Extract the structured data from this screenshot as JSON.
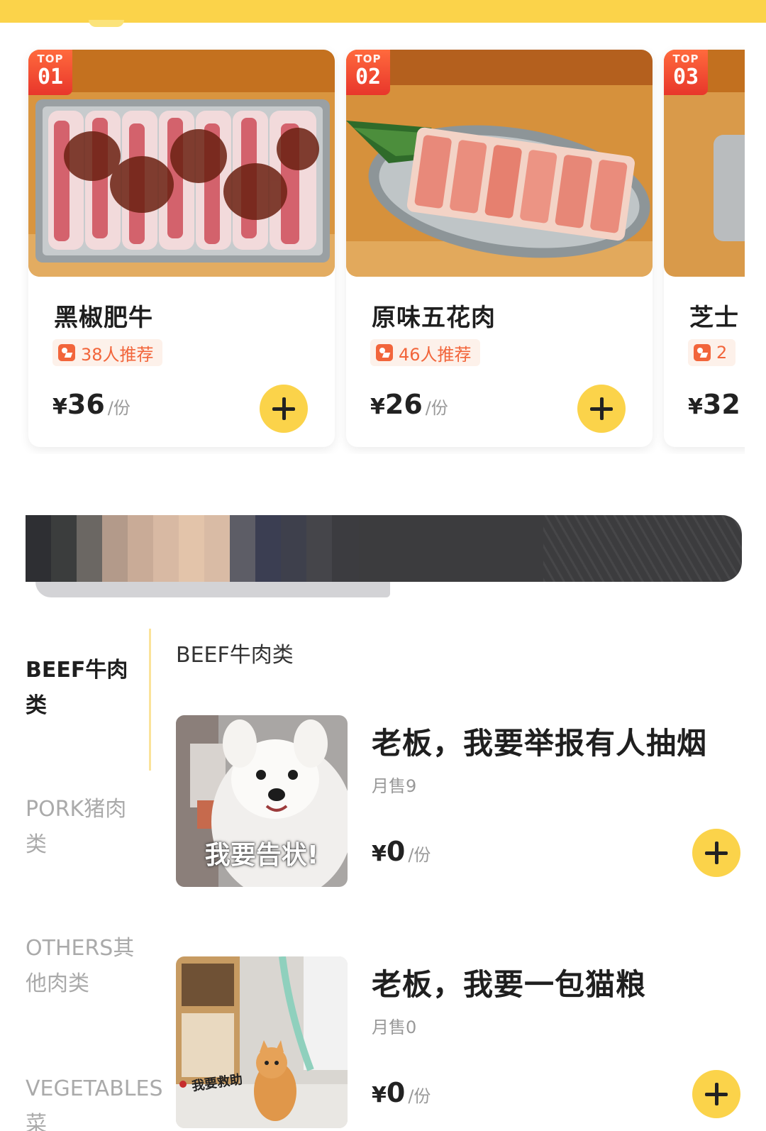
{
  "colors": {
    "accent": "#fbd34a",
    "rank_badge": "#e8362b",
    "recommend": "#f2653b"
  },
  "top_dishes": [
    {
      "rank_top": "TOP",
      "rank_num": "01",
      "name": "黑椒肥牛",
      "recommend": "38人推荐",
      "currency": "¥",
      "price": "36",
      "unit": "/份"
    },
    {
      "rank_top": "TOP",
      "rank_num": "02",
      "name": "原味五花肉",
      "recommend": "46人推荐",
      "currency": "¥",
      "price": "26",
      "unit": "/份"
    },
    {
      "rank_top": "TOP",
      "rank_num": "03",
      "name": "芝士",
      "recommend": "2",
      "currency": "¥",
      "price": "32",
      "unit": ""
    }
  ],
  "categories": [
    {
      "label": "BEEF牛肉类",
      "active": true
    },
    {
      "label": "PORK猪肉类",
      "active": false
    },
    {
      "label": "OTHERS其他肉类",
      "active": false
    },
    {
      "label": "VEGETABLES菜",
      "active": false
    }
  ],
  "section": {
    "title": "BEEF牛肉类"
  },
  "items": [
    {
      "name": "老板，我要举报有人抽烟",
      "sales": "月售9",
      "currency": "¥",
      "price": "0",
      "unit": "/份",
      "image_caption": "我要告状!"
    },
    {
      "name": "老板，我要一包猫粮",
      "sales": "月售0",
      "currency": "¥",
      "price": "0",
      "unit": "/份",
      "image_caption": "我要救助"
    }
  ]
}
